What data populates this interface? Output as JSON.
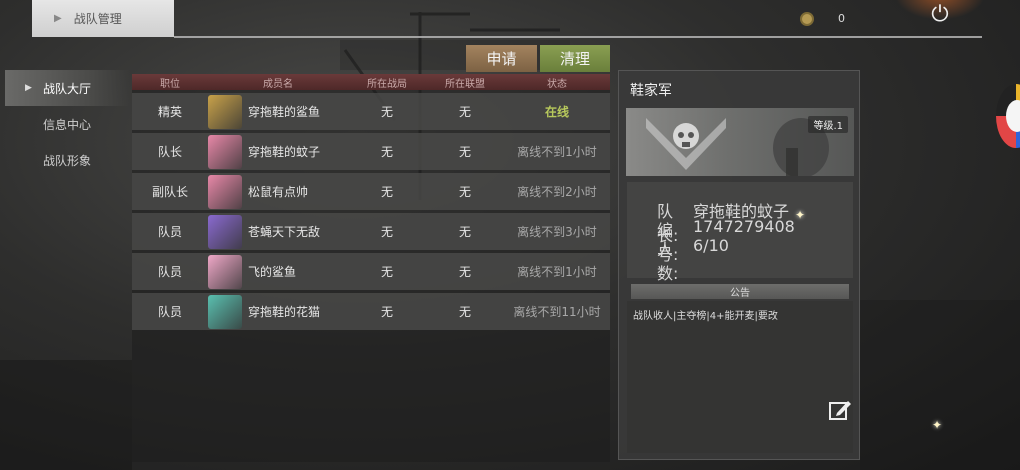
{
  "header": {
    "title": "战队管理",
    "coin_value": "0",
    "power_icon": "power-icon",
    "arrow_icon": "right-arrow-icon"
  },
  "nav": {
    "items": [
      {
        "label": "战队大厅",
        "active": true
      },
      {
        "label": "信息中心",
        "active": false
      },
      {
        "label": "战队形象",
        "active": false
      }
    ]
  },
  "actions": {
    "apply_label": "申请",
    "clear_label": "清理"
  },
  "table": {
    "headers": [
      "职位",
      "成员名",
      "所在战局",
      "所在联盟",
      "状态"
    ],
    "rows": [
      {
        "role": "精英",
        "name": "穿拖鞋的鲨鱼",
        "war": "无",
        "alliance": "无",
        "status": "在线",
        "online": true,
        "avatar_color": "#c9a24a"
      },
      {
        "role": "队长",
        "name": "穿拖鞋的蚊子",
        "war": "无",
        "alliance": "无",
        "status": "离线不到1小时",
        "online": false,
        "avatar_color": "#e888a8"
      },
      {
        "role": "副队长",
        "name": "松鼠有点帅",
        "war": "无",
        "alliance": "无",
        "status": "离线不到2小时",
        "online": false,
        "avatar_color": "#e888a8"
      },
      {
        "role": "队员",
        "name": "苍蝇天下无敌",
        "war": "无",
        "alliance": "无",
        "status": "离线不到3小时",
        "online": false,
        "avatar_color": "#8a6ad0"
      },
      {
        "role": "队员",
        "name": "飞的鲨鱼",
        "war": "无",
        "alliance": "无",
        "status": "离线不到1小时",
        "online": false,
        "avatar_color": "#f0a8c8"
      },
      {
        "role": "队员",
        "name": "穿拖鞋的花猫",
        "war": "无",
        "alliance": "无",
        "status": "离线不到11小时",
        "online": false,
        "avatar_color": "#5ac0b0"
      }
    ]
  },
  "team": {
    "name": "鞋家军",
    "level": "等级.1",
    "leader_label": "队长:",
    "leader": "穿拖鞋的蚊子",
    "id_label": "编号:",
    "id": "1747279408",
    "count_label": "人数:",
    "count": "6/10",
    "notice_title": "公告",
    "notice_text": "战队收人|主夺榜|4+能开麦|要改"
  },
  "colors": {
    "online": "#b8c95c",
    "apply_btn": "#8f7352",
    "clear_btn": "#7a8f47",
    "header_row": "#5a3030"
  }
}
